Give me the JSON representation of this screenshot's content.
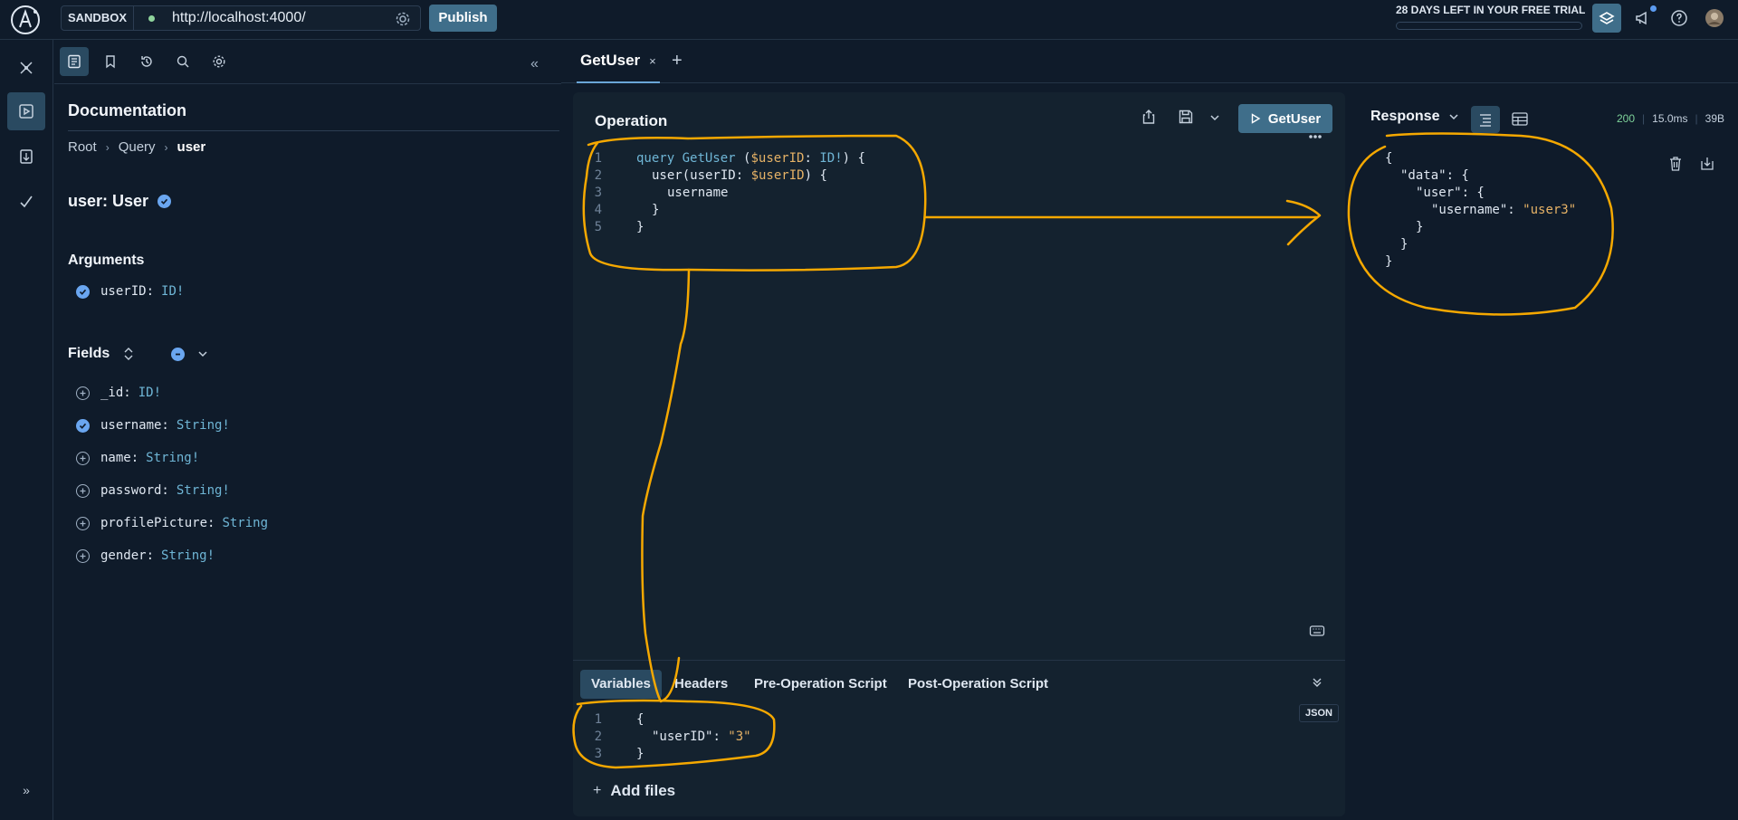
{
  "topbar": {
    "sandbox_label": "SANDBOX",
    "endpoint": "http://localhost:4000/",
    "publish_label": "Publish",
    "trial_text": "28 DAYS LEFT IN YOUR FREE TRIAL"
  },
  "docs": {
    "title": "Documentation",
    "breadcrumb": [
      "Root",
      "Query",
      "user"
    ],
    "type_title": "user: User",
    "arguments_heading": "Arguments",
    "arguments": [
      {
        "name": "userID:",
        "type": "ID!",
        "selected": true
      }
    ],
    "fields_heading": "Fields",
    "fields": [
      {
        "name": "_id:",
        "type": "ID!",
        "selected": false
      },
      {
        "name": "username:",
        "type": "String!",
        "selected": true
      },
      {
        "name": "name:",
        "type": "String!",
        "selected": false
      },
      {
        "name": "password:",
        "type": "String!",
        "selected": false
      },
      {
        "name": "profilePicture:",
        "type": "String",
        "selected": false
      },
      {
        "name": "gender:",
        "type": "String!",
        "selected": false
      }
    ]
  },
  "tabs": [
    {
      "label": "GetUser",
      "close": "×"
    }
  ],
  "tab_add": "+",
  "operation": {
    "title": "Operation",
    "run_label": "GetUser",
    "line_numbers": [
      "1",
      "2",
      "3",
      "4",
      "5"
    ],
    "code": {
      "l1_kw": "query",
      "l1_name": "GetUser",
      "l1_open": " (",
      "l1_var": "$userID",
      "l1_colon": ": ",
      "l1_type": "ID!",
      "l1_close": ") {",
      "l2_field": "user(userID: ",
      "l2_var": "$userID",
      "l2_close": ") {",
      "l3_field": "username",
      "l4": "}",
      "l5": "}"
    }
  },
  "variables": {
    "tabs": [
      "Variables",
      "Headers",
      "Pre-Operation Script",
      "Post-Operation Script"
    ],
    "active_tab": "Variables",
    "json_badge": "JSON",
    "line_numbers": [
      "1",
      "2",
      "3"
    ],
    "l1": "{",
    "l2_key": "\"userID\"",
    "l2_colon": ": ",
    "l2_val": "\"3\"",
    "l3": "}",
    "add_files": "Add files"
  },
  "response": {
    "label": "Response",
    "status": "200",
    "time": "15.0ms",
    "size": "39B",
    "l1": "{",
    "l2_key": "\"data\"",
    "l2_rest": ": {",
    "l3_key": "\"user\"",
    "l3_rest": ": {",
    "l4_key": "\"username\"",
    "l4_colon": ": ",
    "l4_val": "\"user3\"",
    "l5": "}",
    "l6": "}",
    "l7": "}"
  },
  "colors": {
    "background": "#0f1b2a",
    "accent": "#3f6e8a",
    "annotation": "#f5a800"
  }
}
